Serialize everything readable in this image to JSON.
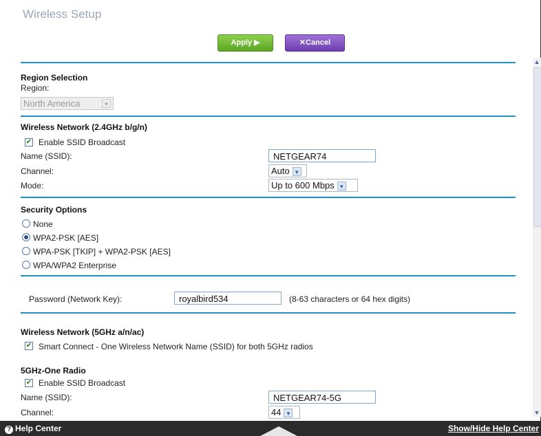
{
  "page_title": "Wireless Setup",
  "toolbar": {
    "apply_label": "Apply ▶",
    "cancel_label": "✕Cancel"
  },
  "region": {
    "heading": "Region Selection",
    "label": "Region:",
    "value": "North America"
  },
  "wifi24": {
    "heading": "Wireless Network (2.4GHz b/g/n)",
    "enable_ssid_label": "Enable SSID Broadcast",
    "name_label": "Name (SSID):",
    "name_value": "NETGEAR74",
    "channel_label": "Channel:",
    "channel_value": "Auto",
    "mode_label": "Mode:",
    "mode_value": "Up to 600 Mbps"
  },
  "security": {
    "heading": "Security Options",
    "options": [
      "None",
      "WPA2-PSK [AES]",
      "WPA-PSK [TKIP] + WPA2-PSK [AES]",
      "WPA/WPA2 Enterprise"
    ],
    "selected": "WPA2-PSK [AES]"
  },
  "password": {
    "label": "Password (Network Key):",
    "value": "royalbird534",
    "hint": "(8-63 characters or 64 hex digits)"
  },
  "wifi5": {
    "heading": "Wireless Network (5GHz a/n/ac)",
    "smart_connect_label": "Smart Connect - One Wireless Network Name (SSID) for both 5GHz radios"
  },
  "radio5": {
    "heading": "5GHz-One Radio",
    "enable_ssid_label": "Enable SSID Broadcast",
    "name_label": "Name (SSID):",
    "name_value": "NETGEAR74-5G",
    "channel_label": "Channel:",
    "channel_value": "44"
  },
  "footer": {
    "help_label": "Help Center",
    "toggle_label": "Show/Hide Help Center"
  }
}
